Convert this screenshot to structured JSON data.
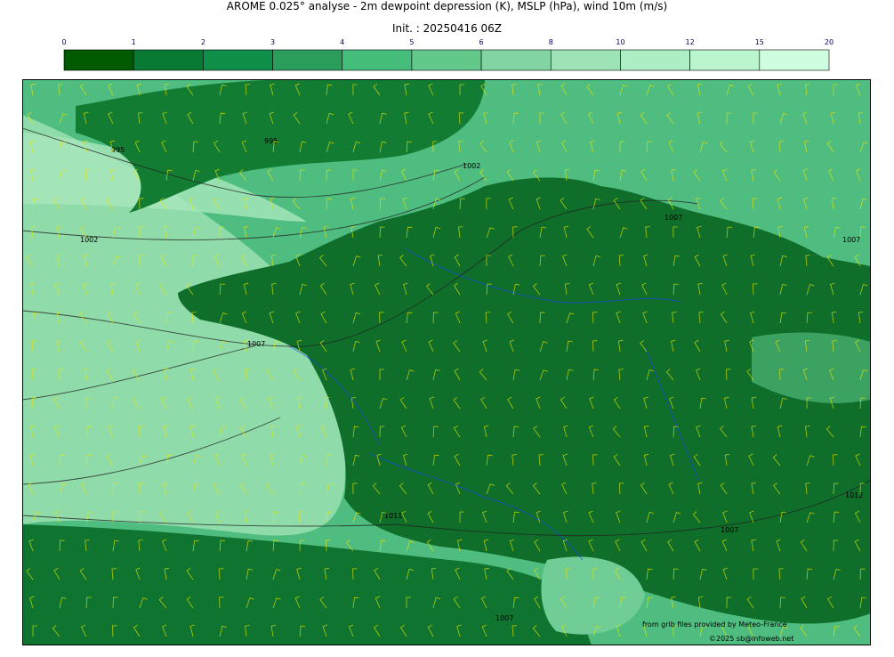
{
  "title": "AROME 0.025° analyse - 2m dewpoint depression (K), MSLP (hPa), wind 10m (m/s)",
  "subtitle": "Init. : 20250416 06Z",
  "colorbar": {
    "ticks": [
      "0",
      "1",
      "2",
      "3",
      "4",
      "5",
      "6",
      "8",
      "10",
      "12",
      "15",
      "20"
    ],
    "colors": [
      "#005a00",
      "#087a34",
      "#0f8f4a",
      "#2b9d5a",
      "#44bc7a",
      "#63c98a",
      "#82d5a2",
      "#9ee3b5",
      "#aeeec4",
      "#baf5d0",
      "#cffde0"
    ]
  },
  "map": {
    "isobar_labels": [
      "995",
      "995",
      "1002",
      "1002",
      "1007",
      "1007",
      "1007",
      "1007",
      "1011",
      "1007",
      "1012",
      "1007"
    ],
    "land_color": "#0b6b26",
    "sea_color": "#5cc488",
    "coast_color": "#000000",
    "river_color": "#1c3cff",
    "barb_color": "#e8e800"
  },
  "credits": {
    "source": "from grib files provided by Meteo-France",
    "copyright": "©2025 sb@infoweb.net"
  }
}
